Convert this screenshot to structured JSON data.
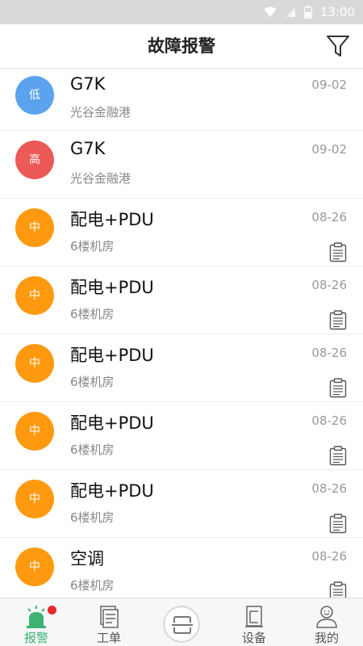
{
  "status_bar": {
    "time": "13:00"
  },
  "header": {
    "title": "故障报警"
  },
  "alarms": [
    {
      "level": "低",
      "level_color": "#5ba3ee",
      "title": "G7K",
      "location": "光谷金融港",
      "date": "09-02",
      "has_clipboard": false
    },
    {
      "level": "高",
      "level_color": "#ec5a57",
      "title": "G7K",
      "location": "光谷金融港",
      "date": "09-02",
      "has_clipboard": false
    },
    {
      "level": "中",
      "level_color": "#ff9a10",
      "title": "配电+PDU",
      "location": "6楼机房",
      "date": "08-26",
      "has_clipboard": true
    },
    {
      "level": "中",
      "level_color": "#ff9a10",
      "title": "配电+PDU",
      "location": "6楼机房",
      "date": "08-26",
      "has_clipboard": true
    },
    {
      "level": "中",
      "level_color": "#ff9a10",
      "title": "配电+PDU",
      "location": "6楼机房",
      "date": "08-26",
      "has_clipboard": true
    },
    {
      "level": "中",
      "level_color": "#ff9a10",
      "title": "配电+PDU",
      "location": "6楼机房",
      "date": "08-26",
      "has_clipboard": true
    },
    {
      "level": "中",
      "level_color": "#ff9a10",
      "title": "配电+PDU",
      "location": "6楼机房",
      "date": "08-26",
      "has_clipboard": true
    },
    {
      "level": "中",
      "level_color": "#ff9a10",
      "title": "空调",
      "location": "6楼机房",
      "date": "08-26",
      "has_clipboard": true
    }
  ],
  "tabbar": {
    "alarm_label": "报警",
    "workorder_label": "工单",
    "device_label": "设备",
    "mine_label": "我的",
    "active_color": "#3cb371"
  }
}
